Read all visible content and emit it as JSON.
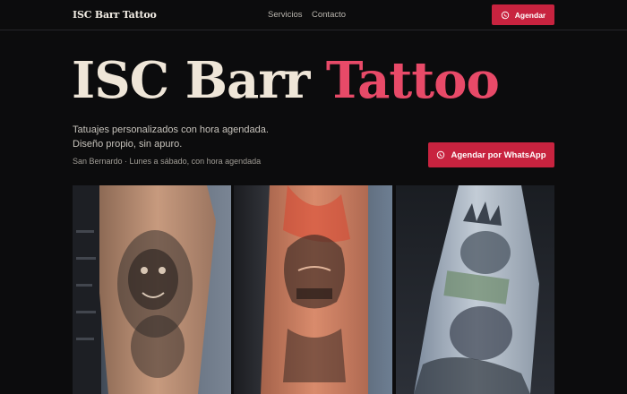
{
  "header": {
    "logo": "ISC Barr Tattoo",
    "nav": [
      "Servicios",
      "Contacto"
    ],
    "cta_label": "Agendar"
  },
  "hero": {
    "title_main": "ISC Barr ",
    "title_accent": "Tattoo",
    "tagline_line1": "Tatuajes personalizados con hora agendada.",
    "tagline_line2": "Diseño propio, sin apuro.",
    "location": "San Bernardo · Lunes a sábado, con hora agendada",
    "cta_label": "Agendar por WhatsApp"
  },
  "colors": {
    "accent": "#c8233f",
    "accent_text": "#e84a68",
    "background": "#0c0c0d"
  },
  "icons": {
    "whatsapp": "whatsapp-icon"
  },
  "gallery": {
    "photos": [
      "tattoo-photo-forearm-lion",
      "tattoo-photo-forearm-samurai-mask",
      "tattoo-photo-arm-statue-of-liberty"
    ]
  }
}
